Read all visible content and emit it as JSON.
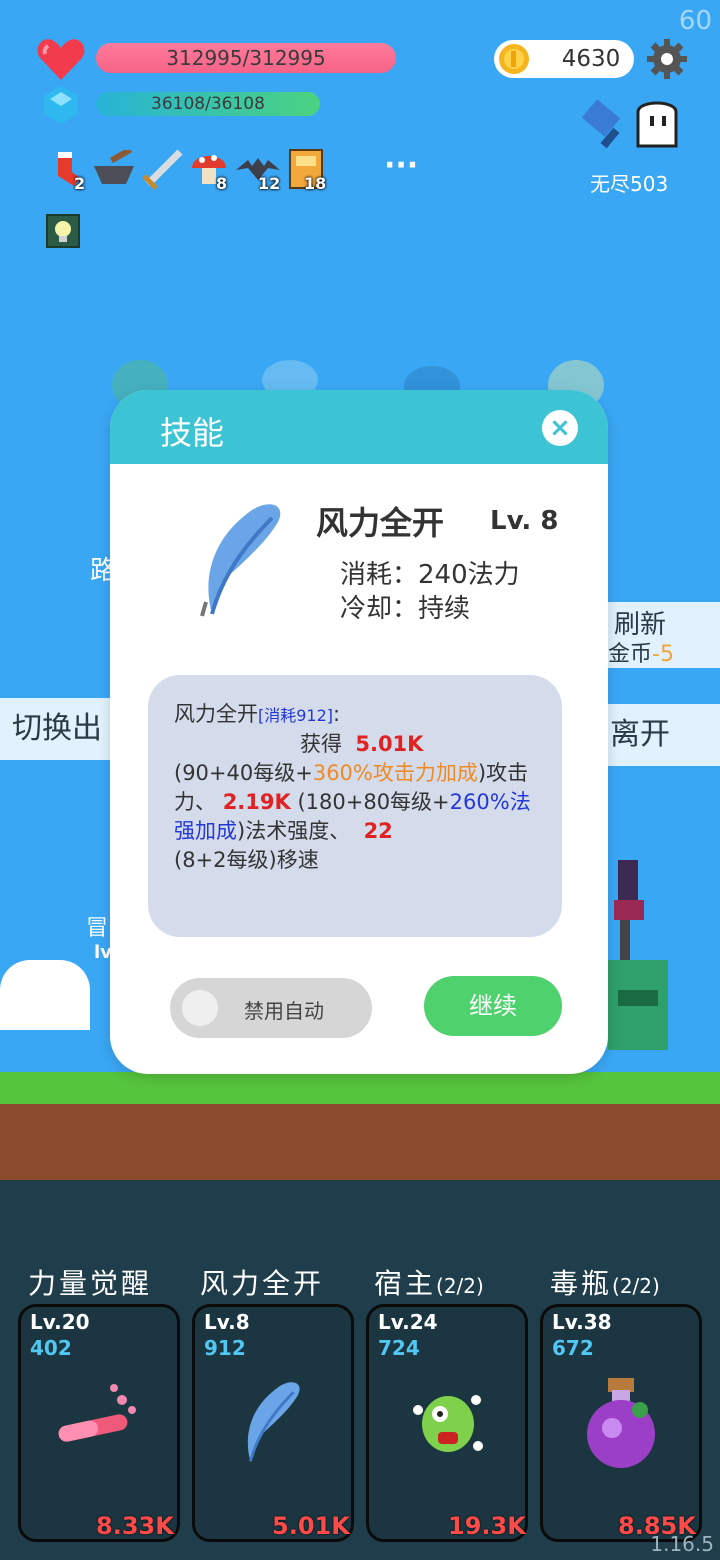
{
  "fps": "60",
  "version": "1.16.5",
  "hud": {
    "hp": "312995/312995",
    "mp": "36108/36108",
    "coins": "4630",
    "stage": "无尽503",
    "items": [
      {
        "icon": "sock-icon",
        "count": "2"
      },
      {
        "icon": "mortar-icon",
        "count": ""
      },
      {
        "icon": "sword-icon",
        "count": ""
      },
      {
        "icon": "mushroom-icon",
        "count": "8"
      },
      {
        "icon": "bat-icon",
        "count": "12"
      },
      {
        "icon": "book-icon",
        "count": "18"
      }
    ],
    "more": "···"
  },
  "background_buttons": {
    "path_partial": "路",
    "refresh_label": "刷新",
    "refresh_cost_label": "金币",
    "refresh_cost_value": "-5",
    "switch_partial": "切换出",
    "leave": "离开",
    "hero_label_partial": "冒",
    "hero_lv_partial": "lv"
  },
  "dialog": {
    "title": "技能",
    "close": "×",
    "skill_name": "风力全开",
    "skill_level": "Lv. 8",
    "cost_line": "消耗：240法力",
    "cooldown_line": "冷却：持续",
    "description": {
      "name": "风力全开",
      "cost_tag": "[消耗912]",
      "colon": ":",
      "gain": "获得",
      "atk_value": "5.01K",
      "atk_base": "(90+40每级+",
      "atk_scale": "360%攻击力加成",
      "atk_suffix": ")攻击力、",
      "sp_value": "2.19K",
      "sp_base": "(180+80每级+",
      "sp_scale": "260%法强加成",
      "sp_suffix": ")法术强度、",
      "ms_value": "22",
      "ms_base": "(8+2每级)移速"
    },
    "auto_toggle": "禁用自动",
    "continue": "继续"
  },
  "skills": [
    {
      "title": "力量觉醒",
      "count": "",
      "level": "Lv.20",
      "cost": "402",
      "damage": "8.33K",
      "icon": "potion-tube-icon"
    },
    {
      "title": "风力全开",
      "count": "",
      "level": "Lv.8",
      "cost": "912",
      "damage": "5.01K",
      "icon": "feather-icon"
    },
    {
      "title": "宿主",
      "count": "(2/2)",
      "level": "Lv.24",
      "cost": "724",
      "damage": "19.3K",
      "icon": "monster-icon"
    },
    {
      "title": "毒瓶",
      "count": "(2/2)",
      "level": "Lv.38",
      "cost": "672",
      "damage": "8.85K",
      "icon": "poison-flask-icon"
    }
  ]
}
